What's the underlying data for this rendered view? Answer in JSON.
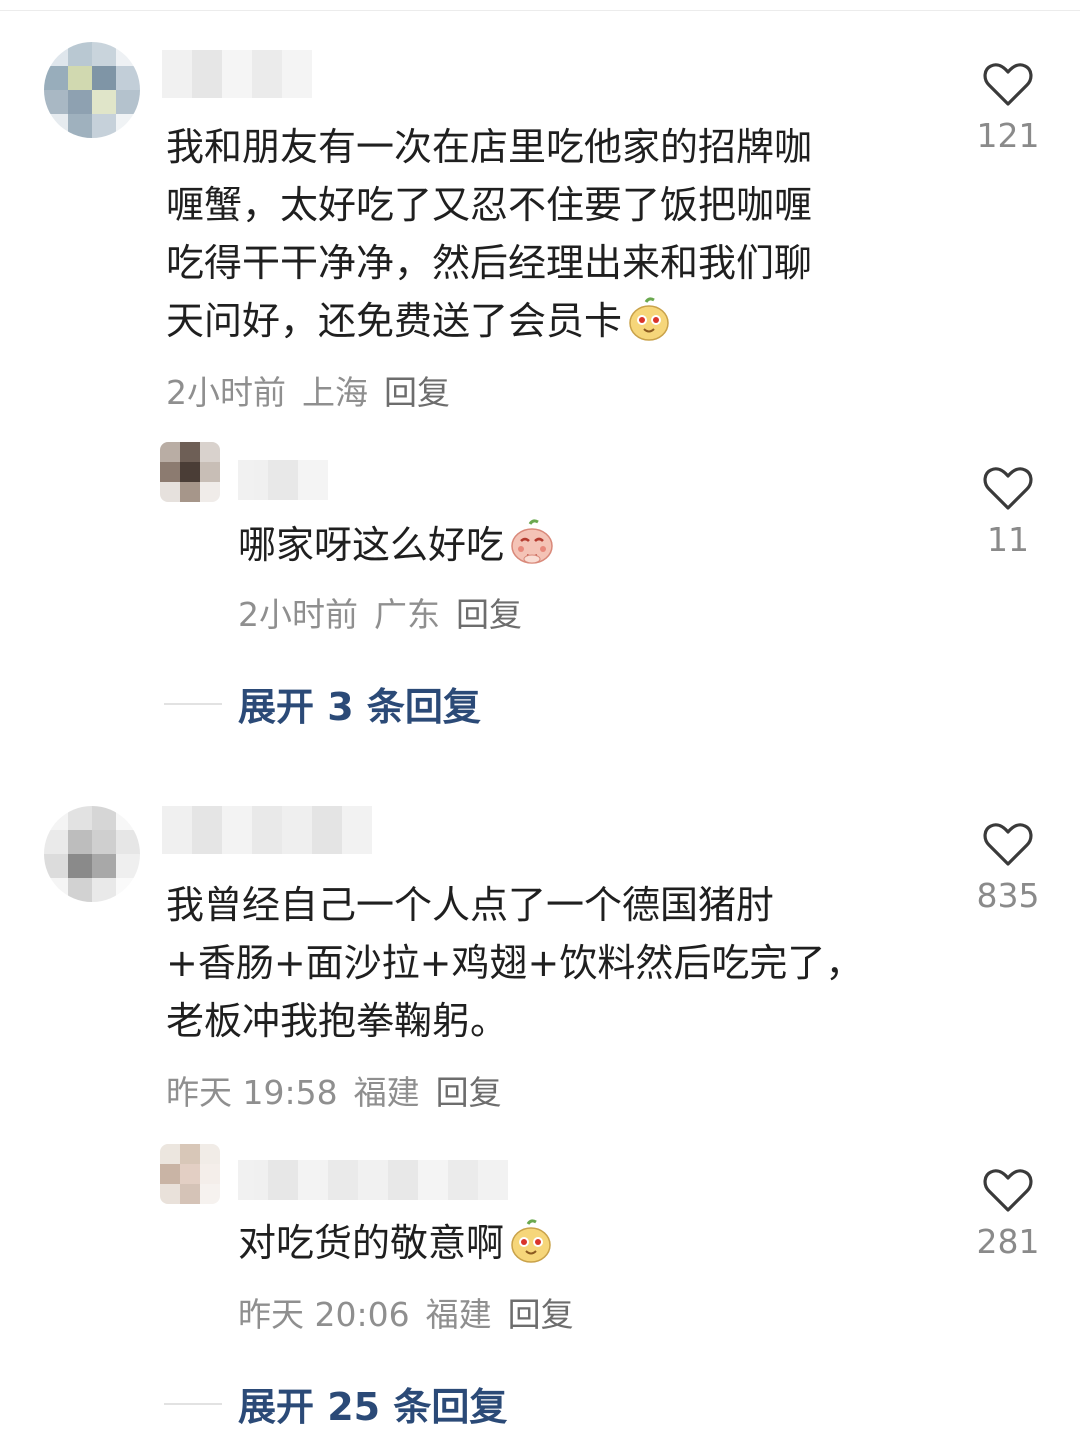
{
  "comments": [
    {
      "text": "我和朋友有一次在店里吃他家的招牌咖\n喱蟹，太好吃了又忍不住要了饭把咖喱\n吃得干干净净，然后经理出来和我们聊\n天问好，还免费送了会员卡",
      "emoji": "happy-face-emoji",
      "time": "2小时前",
      "location": "上海",
      "reply": "回复",
      "likes": "121",
      "sub_reply": {
        "text": "哪家呀这么好吃",
        "emoji": "pleading-face-emoji",
        "time": "2小时前",
        "location": "广东",
        "reply": "回复",
        "likes": "11"
      },
      "expand": "展开 3 条回复"
    },
    {
      "text": "我曾经自己一个人点了一个德国猪肘\n+香肠+面沙拉+鸡翅+饮料然后吃完了，\n老板冲我抱拳鞠躬。",
      "time": "昨天 19:58",
      "location": "福建",
      "reply": "回复",
      "likes": "835",
      "sub_reply": {
        "text": "对吃货的敬意啊",
        "emoji": "happy-face-emoji",
        "time": "昨天 20:06",
        "location": "福建",
        "reply": "回复",
        "likes": "281"
      },
      "expand": "展开 25 条回复"
    }
  ],
  "colors": {
    "text": "#1f1f1f",
    "meta": "#8f8f8f",
    "link": "#2b4a77",
    "heart": "#3a3a3a"
  },
  "icons": {
    "like": "heart-outline-icon"
  }
}
